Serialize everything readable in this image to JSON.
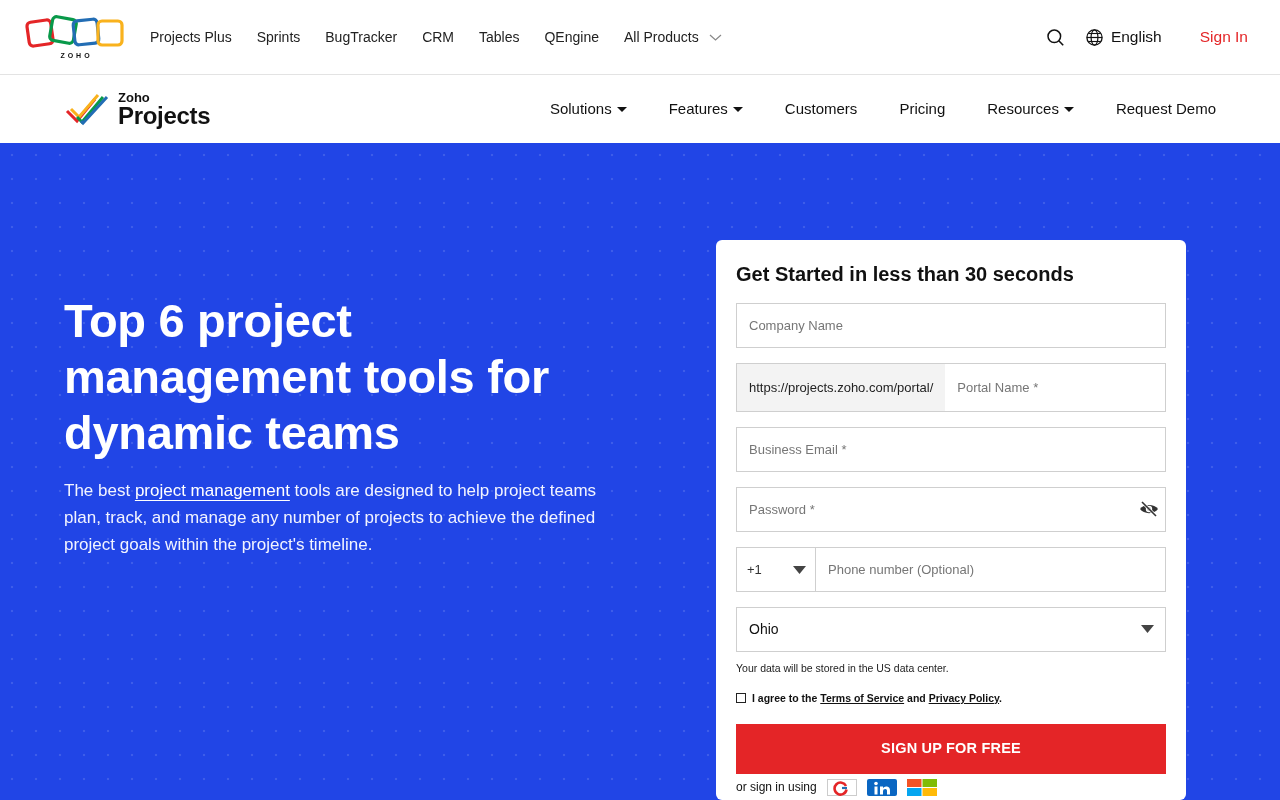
{
  "top_bar": {
    "logo_text": "ZOHO",
    "products": [
      {
        "label": "Projects Plus"
      },
      {
        "label": "Sprints"
      },
      {
        "label": "BugTracker"
      },
      {
        "label": "CRM"
      },
      {
        "label": "Tables"
      },
      {
        "label": "QEngine"
      }
    ],
    "all_products": "All Products",
    "language": "English",
    "sign_in": "Sign In"
  },
  "main_nav": {
    "brand": {
      "small": "Zoho",
      "large": "Projects"
    },
    "items": [
      {
        "label": "Solutions",
        "has_menu": true
      },
      {
        "label": "Features",
        "has_menu": true
      },
      {
        "label": "Customers",
        "has_menu": false
      },
      {
        "label": "Pricing",
        "has_menu": false
      },
      {
        "label": "Resources",
        "has_menu": true
      },
      {
        "label": "Request Demo",
        "has_menu": false
      }
    ]
  },
  "hero": {
    "title": "Top 6 project management tools for dynamic teams",
    "description": {
      "before": "The best",
      "link": "project management",
      "after": "tools are designed to help project teams plan, track, and manage any number of projects to achieve the defined project goals within the project's timeline."
    }
  },
  "signup_form": {
    "title": "Get Started in less than 30 seconds",
    "fields": [
      {
        "kind": "text",
        "placeholder": "Company Name"
      },
      {
        "kind": "prefixed",
        "prefix": "https://projects.zoho.com/portal/",
        "placeholder": "Portal Name *"
      },
      {
        "kind": "email",
        "placeholder": "Business Email *"
      },
      {
        "kind": "password",
        "placeholder": "Password *"
      },
      {
        "kind": "phone",
        "code": "+1",
        "placeholder": "Phone number (Optional)"
      },
      {
        "kind": "select",
        "value": "Ohio"
      }
    ],
    "storage_note": "Your data will be stored in the US data center.",
    "agreement": {
      "checked": false,
      "before": "I agree to the",
      "terms": "Terms of Service",
      "middle": "and",
      "privacy": "Privacy Policy",
      "after": "."
    },
    "submit": "SIGN UP FOR FREE",
    "social": {
      "label": "or sign in using",
      "providers": [
        {
          "kind": "google"
        },
        {
          "kind": "linkedin"
        },
        {
          "kind": "microsoft"
        }
      ]
    }
  }
}
